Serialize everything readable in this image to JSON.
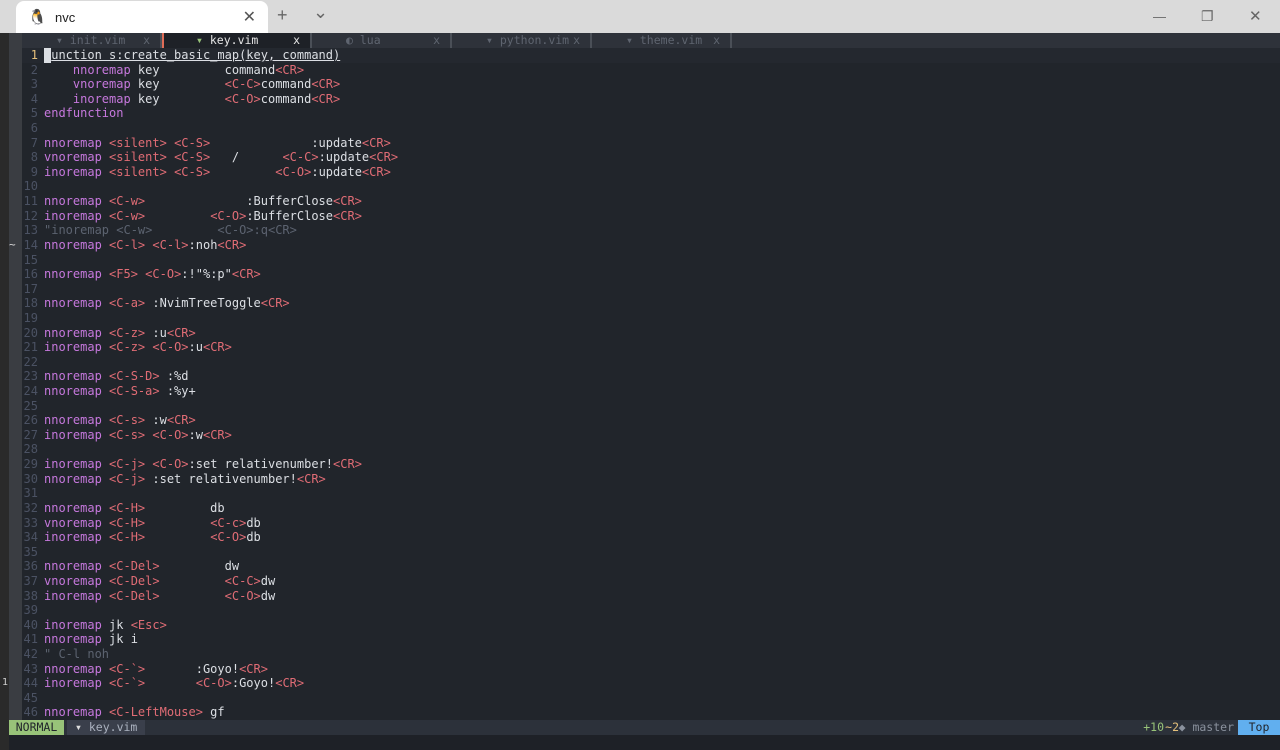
{
  "window": {
    "title": "nvc",
    "new_tab": "+",
    "dropdown": "⌄",
    "minimize": "—",
    "maximize": "❐",
    "close": "✕",
    "tab_close": "✕",
    "tab_icon": "linux-penguin-icon"
  },
  "buffers": [
    {
      "name": "init.vim",
      "icon": "▾",
      "close": "x",
      "active": false
    },
    {
      "name": "key.vim",
      "icon": "▾",
      "close": "x",
      "active": true
    },
    {
      "name": "lua",
      "icon": "◐",
      "close": "x",
      "active": false
    },
    {
      "name": "python.vim",
      "icon": "▾",
      "close": "x",
      "active": false
    },
    {
      "name": "theme.vim",
      "icon": "▾",
      "close": "x",
      "active": false
    }
  ],
  "lines": [
    [
      [
        "t",
        "unction s:create_basic_map(key, command)"
      ]
    ],
    [
      [
        "t",
        "    "
      ],
      [
        "k",
        "nnoremap"
      ],
      [
        "t",
        " key         command"
      ],
      [
        "s",
        "<CR>"
      ]
    ],
    [
      [
        "t",
        "    "
      ],
      [
        "k",
        "vnoremap"
      ],
      [
        "t",
        " key         "
      ],
      [
        "s",
        "<C-C>"
      ],
      [
        "t",
        "command"
      ],
      [
        "s",
        "<CR>"
      ]
    ],
    [
      [
        "t",
        "    "
      ],
      [
        "k",
        "inoremap"
      ],
      [
        "t",
        " key         "
      ],
      [
        "s",
        "<C-O>"
      ],
      [
        "t",
        "command"
      ],
      [
        "s",
        "<CR>"
      ]
    ],
    [
      [
        "k",
        "endfunction"
      ]
    ],
    [],
    [
      [
        "k",
        "nnoremap"
      ],
      [
        "t",
        " "
      ],
      [
        "s",
        "<silent>"
      ],
      [
        "t",
        " "
      ],
      [
        "s",
        "<C-S>"
      ],
      [
        "t",
        "              :update"
      ],
      [
        "s",
        "<CR>"
      ]
    ],
    [
      [
        "k",
        "vnoremap"
      ],
      [
        "t",
        " "
      ],
      [
        "s",
        "<silent>"
      ],
      [
        "t",
        " "
      ],
      [
        "s",
        "<C-S>"
      ],
      [
        "t",
        "   /      "
      ],
      [
        "s",
        "<C-C>"
      ],
      [
        "t",
        ":update"
      ],
      [
        "s",
        "<CR>"
      ]
    ],
    [
      [
        "k",
        "inoremap"
      ],
      [
        "t",
        " "
      ],
      [
        "s",
        "<silent>"
      ],
      [
        "t",
        " "
      ],
      [
        "s",
        "<C-S>"
      ],
      [
        "t",
        "         "
      ],
      [
        "s",
        "<C-O>"
      ],
      [
        "t",
        ":update"
      ],
      [
        "s",
        "<CR>"
      ]
    ],
    [],
    [
      [
        "k",
        "nnoremap"
      ],
      [
        "t",
        " "
      ],
      [
        "s",
        "<C-w>"
      ],
      [
        "t",
        "              :BufferClose"
      ],
      [
        "s",
        "<CR>"
      ]
    ],
    [
      [
        "k",
        "inoremap"
      ],
      [
        "t",
        " "
      ],
      [
        "s",
        "<C-w>"
      ],
      [
        "t",
        "         "
      ],
      [
        "s",
        "<C-O>"
      ],
      [
        "t",
        ":BufferClose"
      ],
      [
        "s",
        "<CR>"
      ]
    ],
    [
      [
        "c",
        "\"inoremap <C-w>         <C-O>:q<CR>"
      ]
    ],
    [
      [
        "k",
        "nnoremap"
      ],
      [
        "t",
        " "
      ],
      [
        "s",
        "<C-l>"
      ],
      [
        "t",
        " "
      ],
      [
        "s",
        "<C-l>"
      ],
      [
        "t",
        ":noh"
      ],
      [
        "s",
        "<CR>"
      ]
    ],
    [],
    [
      [
        "k",
        "nnoremap"
      ],
      [
        "t",
        " "
      ],
      [
        "s",
        "<F5>"
      ],
      [
        "t",
        " "
      ],
      [
        "s",
        "<C-O>"
      ],
      [
        "t",
        ":!\"%:p\""
      ],
      [
        "s",
        "<CR>"
      ]
    ],
    [],
    [
      [
        "k",
        "nnoremap"
      ],
      [
        "t",
        " "
      ],
      [
        "s",
        "<C-a>"
      ],
      [
        "t",
        " :NvimTreeToggle"
      ],
      [
        "s",
        "<CR>"
      ]
    ],
    [],
    [
      [
        "k",
        "nnoremap"
      ],
      [
        "t",
        " "
      ],
      [
        "s",
        "<C-z>"
      ],
      [
        "t",
        " :u"
      ],
      [
        "s",
        "<CR>"
      ]
    ],
    [
      [
        "k",
        "inoremap"
      ],
      [
        "t",
        " "
      ],
      [
        "s",
        "<C-z>"
      ],
      [
        "t",
        " "
      ],
      [
        "s",
        "<C-O>"
      ],
      [
        "t",
        ":u"
      ],
      [
        "s",
        "<CR>"
      ]
    ],
    [],
    [
      [
        "k",
        "nnoremap"
      ],
      [
        "t",
        " "
      ],
      [
        "s",
        "<C-S-D>"
      ],
      [
        "t",
        " :%d"
      ]
    ],
    [
      [
        "k",
        "nnoremap"
      ],
      [
        "t",
        " "
      ],
      [
        "s",
        "<C-S-a>"
      ],
      [
        "t",
        " :%y+"
      ]
    ],
    [],
    [
      [
        "k",
        "nnoremap"
      ],
      [
        "t",
        " "
      ],
      [
        "s",
        "<C-s>"
      ],
      [
        "t",
        " :w"
      ],
      [
        "s",
        "<CR>"
      ]
    ],
    [
      [
        "k",
        "inoremap"
      ],
      [
        "t",
        " "
      ],
      [
        "s",
        "<C-s>"
      ],
      [
        "t",
        " "
      ],
      [
        "s",
        "<C-O>"
      ],
      [
        "t",
        ":w"
      ],
      [
        "s",
        "<CR>"
      ]
    ],
    [],
    [
      [
        "k",
        "inoremap"
      ],
      [
        "t",
        " "
      ],
      [
        "s",
        "<C-j>"
      ],
      [
        "t",
        " "
      ],
      [
        "s",
        "<C-O>"
      ],
      [
        "t",
        ":set relativenumber!"
      ],
      [
        "s",
        "<CR>"
      ]
    ],
    [
      [
        "k",
        "nnoremap"
      ],
      [
        "t",
        " "
      ],
      [
        "s",
        "<C-j>"
      ],
      [
        "t",
        " :set relativenumber!"
      ],
      [
        "s",
        "<CR>"
      ]
    ],
    [],
    [
      [
        "k",
        "nnoremap"
      ],
      [
        "t",
        " "
      ],
      [
        "s",
        "<C-H>"
      ],
      [
        "t",
        "         db"
      ]
    ],
    [
      [
        "k",
        "vnoremap"
      ],
      [
        "t",
        " "
      ],
      [
        "s",
        "<C-H>"
      ],
      [
        "t",
        "         "
      ],
      [
        "s",
        "<C-c>"
      ],
      [
        "t",
        "db"
      ]
    ],
    [
      [
        "k",
        "inoremap"
      ],
      [
        "t",
        " "
      ],
      [
        "s",
        "<C-H>"
      ],
      [
        "t",
        "         "
      ],
      [
        "s",
        "<C-O>"
      ],
      [
        "t",
        "db"
      ]
    ],
    [],
    [
      [
        "k",
        "nnoremap"
      ],
      [
        "t",
        " "
      ],
      [
        "s",
        "<C-Del>"
      ],
      [
        "t",
        "         dw"
      ]
    ],
    [
      [
        "k",
        "vnoremap"
      ],
      [
        "t",
        " "
      ],
      [
        "s",
        "<C-Del>"
      ],
      [
        "t",
        "         "
      ],
      [
        "s",
        "<C-C>"
      ],
      [
        "t",
        "dw"
      ]
    ],
    [
      [
        "k",
        "inoremap"
      ],
      [
        "t",
        " "
      ],
      [
        "s",
        "<C-Del>"
      ],
      [
        "t",
        "         "
      ],
      [
        "s",
        "<C-O>"
      ],
      [
        "t",
        "dw"
      ]
    ],
    [],
    [
      [
        "k",
        "inoremap"
      ],
      [
        "t",
        " jk "
      ],
      [
        "s",
        "<Esc>"
      ]
    ],
    [
      [
        "k",
        "nnoremap"
      ],
      [
        "t",
        " jk i"
      ]
    ],
    [
      [
        "c",
        "\" C-l noh"
      ]
    ],
    [
      [
        "k",
        "nnoremap"
      ],
      [
        "t",
        " "
      ],
      [
        "s",
        "<C-`>"
      ],
      [
        "t",
        "       :Goyo!"
      ],
      [
        "s",
        "<CR>"
      ]
    ],
    [
      [
        "k",
        "inoremap"
      ],
      [
        "t",
        " "
      ],
      [
        "s",
        "<C-`>"
      ],
      [
        "t",
        "       "
      ],
      [
        "s",
        "<C-O>"
      ],
      [
        "t",
        ":Goyo!"
      ],
      [
        "s",
        "<CR>"
      ]
    ],
    [],
    [
      [
        "k",
        "nnoremap"
      ],
      [
        "t",
        " "
      ],
      [
        "s",
        "<C-LeftMouse>"
      ],
      [
        "t",
        " gf"
      ]
    ]
  ],
  "statusline": {
    "mode": "NORMAL",
    "file_icon": "▾",
    "file": "key.vim",
    "git_added": "+10",
    "git_modified": "~2",
    "branch_icon": "◆",
    "branch": "master",
    "position": "Top"
  },
  "gutter_marks": {
    "tilde": "~",
    "one": "1"
  },
  "colors": {
    "keyword": "#c678dd",
    "special": "#e06c75",
    "text": "#dcdfe4",
    "comment": "#5c6370",
    "mode_bg": "#98c379",
    "pos_bg": "#61afef"
  }
}
